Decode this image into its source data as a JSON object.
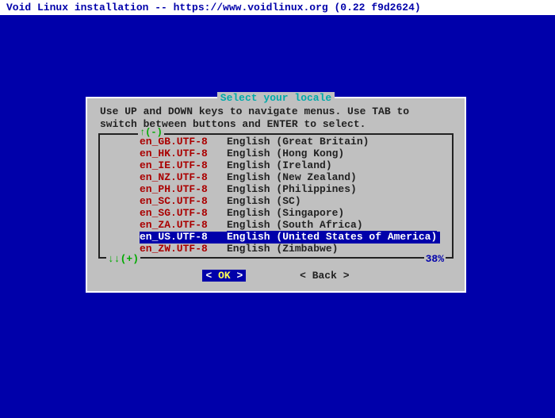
{
  "title_bar": "Void Linux installation -- https://www.voidlinux.org (0.22 f9d2624)",
  "dialog": {
    "title": "Select your locale",
    "instructions": "Use UP and DOWN keys to navigate menus. Use TAB to switch between buttons and ENTER to select.",
    "list_top_indicator": "↑(-)",
    "list_bottom_left": "↓↓(+)",
    "percent": "38%",
    "locales": [
      {
        "code": "en_GB.UTF-8",
        "desc": "English (Great Britain)",
        "selected": false
      },
      {
        "code": "en_HK.UTF-8",
        "desc": "English (Hong Kong)",
        "selected": false
      },
      {
        "code": "en_IE.UTF-8",
        "desc": "English (Ireland)",
        "selected": false
      },
      {
        "code": "en_NZ.UTF-8",
        "desc": "English (New Zealand)",
        "selected": false
      },
      {
        "code": "en_PH.UTF-8",
        "desc": "English (Philippines)",
        "selected": false
      },
      {
        "code": "en_SC.UTF-8",
        "desc": "English (SC)",
        "selected": false
      },
      {
        "code": "en_SG.UTF-8",
        "desc": "English (Singapore)",
        "selected": false
      },
      {
        "code": "en_ZA.UTF-8",
        "desc": "English (South Africa)",
        "selected": false
      },
      {
        "code": "en_US.UTF-8",
        "desc": "English (United States of America)",
        "selected": true
      },
      {
        "code": "en_ZW.UTF-8",
        "desc": "English (Zimbabwe)",
        "selected": false
      }
    ],
    "ok_label": "OK",
    "back_label": "Back"
  }
}
